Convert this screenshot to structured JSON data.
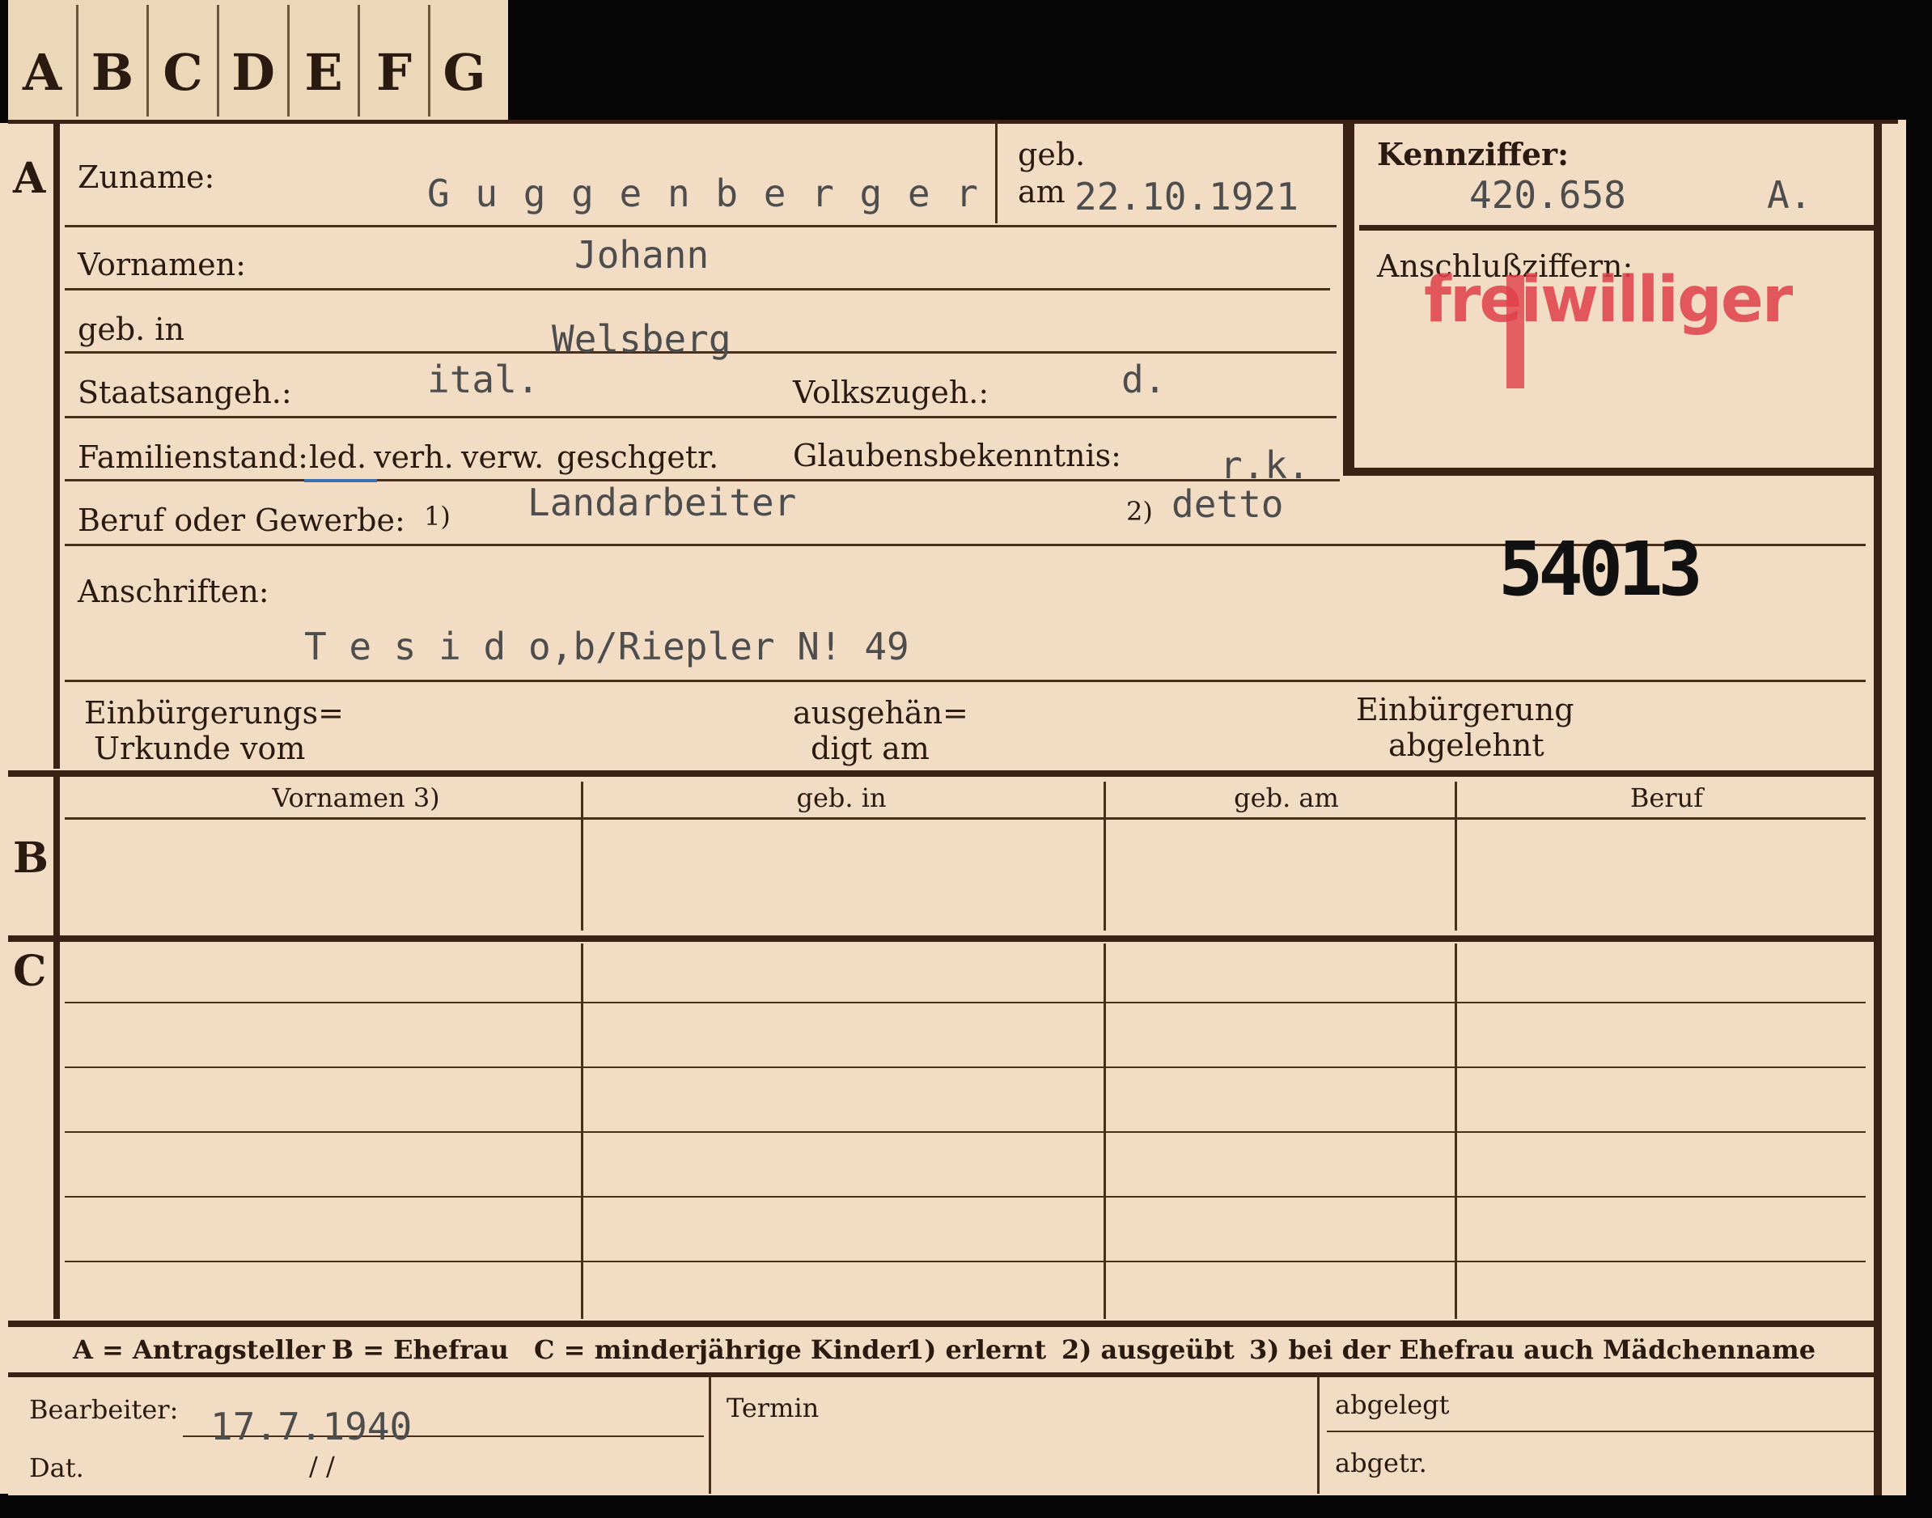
{
  "tabs": [
    "A",
    "B",
    "C",
    "D",
    "E",
    "F",
    "G"
  ],
  "sections": {
    "a": "A",
    "b": "B",
    "c": "C"
  },
  "labels": {
    "zuname": "Zuname:",
    "geb": "geb.",
    "am": "am",
    "vornamen": "Vornamen:",
    "geb_in": "geb. in",
    "staatsangeh": "Staatsangeh.:",
    "volkszugeh": "Volkszugeh.:",
    "familienstand": "Familienstand:",
    "familienstand_options": [
      "led.",
      "verh.",
      "verw.",
      "gesch.",
      "getr."
    ],
    "glaubensbekenntnis": "Glaubensbekenntnis:",
    "beruf": "Beruf oder Gewerbe:",
    "beruf_fn1": "1)",
    "beruf_fn2": "2)",
    "anschriften": "Anschriften:",
    "einbuergerungs_urkunde_1": "Einbürgerungs=",
    "einbuergerungs_urkunde_2": "Urkunde vom",
    "ausgehaen_1": "ausgehän=",
    "ausgehaen_2": "digt am",
    "einbuergerung_abgelehnt_1": "Einbürgerung",
    "einbuergerung_abgelehnt_2": "abgelehnt",
    "kennziffer": "Kennziffer:",
    "anschlussziffern": "Anschlußziffern:"
  },
  "values": {
    "zuname": "G u g g e n b e r g e r",
    "geb_am": "22.10.1921",
    "vornamen": "Johann",
    "geb_in": "Welsberg",
    "staatsangeh": "ital.",
    "volkszugeh": "d.",
    "glaubensbekenntnis": "r.k.",
    "beruf_1": "Landarbeiter",
    "beruf_2": "detto",
    "anschrift": "T e s i d o,b/Riepler N! 49",
    "kennziffer": "420.658",
    "kennziffer_suffix": "A.",
    "stamp_red": "freiwilliger",
    "stamp_number": "54013"
  },
  "table": {
    "headers": [
      "Vornamen 3)",
      "geb. in",
      "geb. am",
      "Beruf"
    ]
  },
  "legend": {
    "a": "A = Antragsteller",
    "b": "B = Ehefrau",
    "c": "C = minderjährige Kinder",
    "f1": "1) erlernt",
    "f2": "2) ausgeübt",
    "f3": "3) bei der Ehefrau auch Mädchenname"
  },
  "footer": {
    "bearbeiter": "Bearbeiter:",
    "bearbeiter_value": "17.7.1940",
    "dat": "Dat.",
    "dat_value": "/        /",
    "termin": "Termin",
    "abgelegt": "abgelegt",
    "abgetr": "abgetr."
  }
}
